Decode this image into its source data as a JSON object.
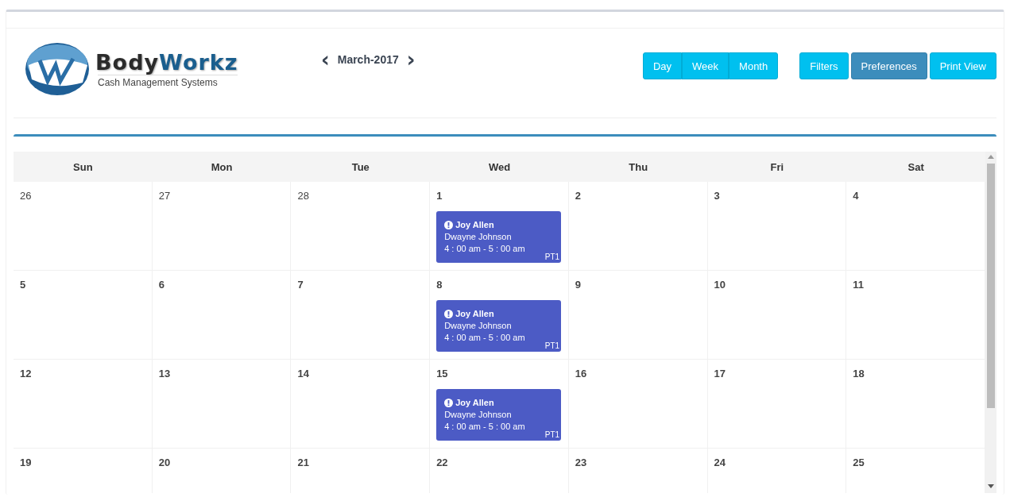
{
  "logo": {
    "name_dark": "Body",
    "name_blue": "Workz",
    "tagline": "Cash Management Systems"
  },
  "month_nav": {
    "prev": "‹",
    "label": "March-2017",
    "next": "›"
  },
  "view_buttons": [
    {
      "label": "Day"
    },
    {
      "label": "Week"
    },
    {
      "label": "Month"
    }
  ],
  "action_buttons": [
    {
      "label": "Filters",
      "selected": false
    },
    {
      "label": "Preferences",
      "selected": true
    },
    {
      "label": "Print View",
      "selected": false
    }
  ],
  "calendar": {
    "weekdays": [
      "Sun",
      "Mon",
      "Tue",
      "Wed",
      "Thu",
      "Fri",
      "Sat"
    ],
    "weeks": [
      [
        {
          "day": "26",
          "other_month": true
        },
        {
          "day": "27",
          "other_month": true
        },
        {
          "day": "28",
          "other_month": true
        },
        {
          "day": "1",
          "other_month": false,
          "events": [
            {
              "title": "Joy Allen",
              "person": "Dwayne Johnson",
              "time": "4 : 00 am - 5 : 00 am",
              "code": "PT1"
            }
          ]
        },
        {
          "day": "2",
          "other_month": false
        },
        {
          "day": "3",
          "other_month": false
        },
        {
          "day": "4",
          "other_month": false
        }
      ],
      [
        {
          "day": "5",
          "other_month": false
        },
        {
          "day": "6",
          "other_month": false
        },
        {
          "day": "7",
          "other_month": false
        },
        {
          "day": "8",
          "other_month": false,
          "events": [
            {
              "title": "Joy Allen",
              "person": "Dwayne Johnson",
              "time": "4 : 00 am - 5 : 00 am",
              "code": "PT1"
            }
          ]
        },
        {
          "day": "9",
          "other_month": false
        },
        {
          "day": "10",
          "other_month": false
        },
        {
          "day": "11",
          "other_month": false
        }
      ],
      [
        {
          "day": "12",
          "other_month": false
        },
        {
          "day": "13",
          "other_month": false
        },
        {
          "day": "14",
          "other_month": false
        },
        {
          "day": "15",
          "other_month": false,
          "events": [
            {
              "title": "Joy Allen",
              "person": "Dwayne Johnson",
              "time": "4 : 00 am - 5 : 00 am",
              "code": "PT1"
            }
          ]
        },
        {
          "day": "16",
          "other_month": false
        },
        {
          "day": "17",
          "other_month": false
        },
        {
          "day": "18",
          "other_month": false
        }
      ],
      [
        {
          "day": "19",
          "other_month": false
        },
        {
          "day": "20",
          "other_month": false
        },
        {
          "day": "21",
          "other_month": false
        },
        {
          "day": "22",
          "other_month": false
        },
        {
          "day": "23",
          "other_month": false
        },
        {
          "day": "24",
          "other_month": false
        },
        {
          "day": "25",
          "other_month": false
        }
      ]
    ]
  }
}
